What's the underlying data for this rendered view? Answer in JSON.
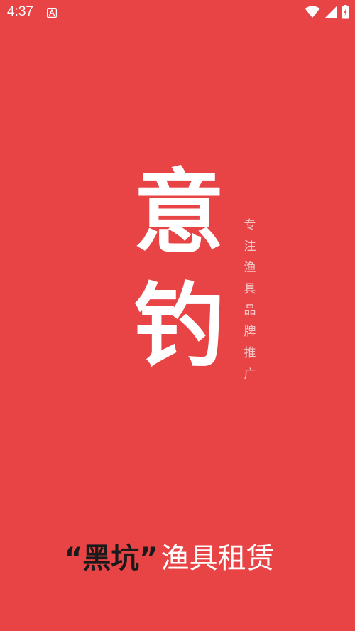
{
  "status_bar": {
    "time": "4:37",
    "icons": [
      "notification-a-icon",
      "wifi-icon",
      "cellular-signal-icon",
      "battery-icon"
    ]
  },
  "splash": {
    "background_color": "#e84446",
    "logo_chars": [
      "意",
      "钓"
    ],
    "tagline": "专注渔具品牌推广",
    "slogan_quoted": "“黑坑”",
    "slogan_rest": "渔具租赁"
  }
}
